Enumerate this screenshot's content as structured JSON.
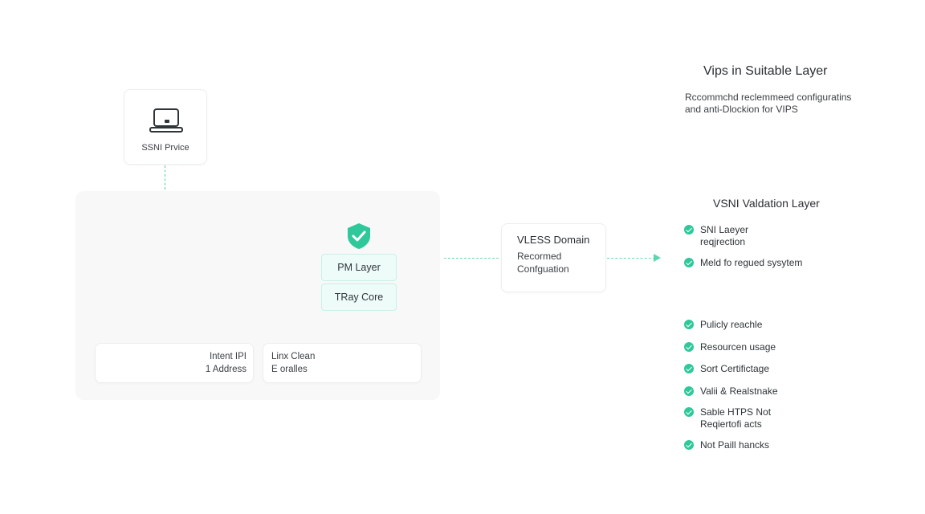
{
  "device": {
    "label": "SSNI Prvice",
    "icon": "laptop-icon"
  },
  "core_panel": {
    "shield_icon": "shield-check-icon",
    "layers": [
      "PM Layer",
      "TRay Core"
    ],
    "info_left": [
      "Intent IPI",
      "1 Address"
    ],
    "info_right": [
      "Linx Clean",
      "E oralles"
    ]
  },
  "vless": {
    "title": "VLESS Domain",
    "line1": "Recormed",
    "line2": "Confguation"
  },
  "right_panel": {
    "title": "Vips in Suitable Layer",
    "desc_line1": "Rccommchd reclemmeed configuratins",
    "desc_line2": "and anti-Dlockion for VIPS",
    "section_title": "VSNI Valdation Layer",
    "validation_items": [
      {
        "line1": "SNI Laeyer",
        "line2": "reqjrection"
      },
      {
        "line1": "Meld fo regued sysytem",
        "line2": ""
      }
    ],
    "feature_items": [
      {
        "line1": "Pulicly reachle",
        "line2": ""
      },
      {
        "line1": "Resourcen usage",
        "line2": ""
      },
      {
        "line1": "Sort Certifictage",
        "line2": ""
      },
      {
        "line1": "Valii & Realstnake",
        "line2": ""
      },
      {
        "line1": "Sable HTPS Not",
        "line2": "Reqiertofi acts"
      },
      {
        "line1": "Not Paill hancks",
        "line2": ""
      }
    ]
  },
  "colors": {
    "accent": "#2ec89a",
    "dash": "#6fd8b8",
    "layer_bg": "#eefcf9",
    "panel_bg": "#f8f8f9"
  }
}
